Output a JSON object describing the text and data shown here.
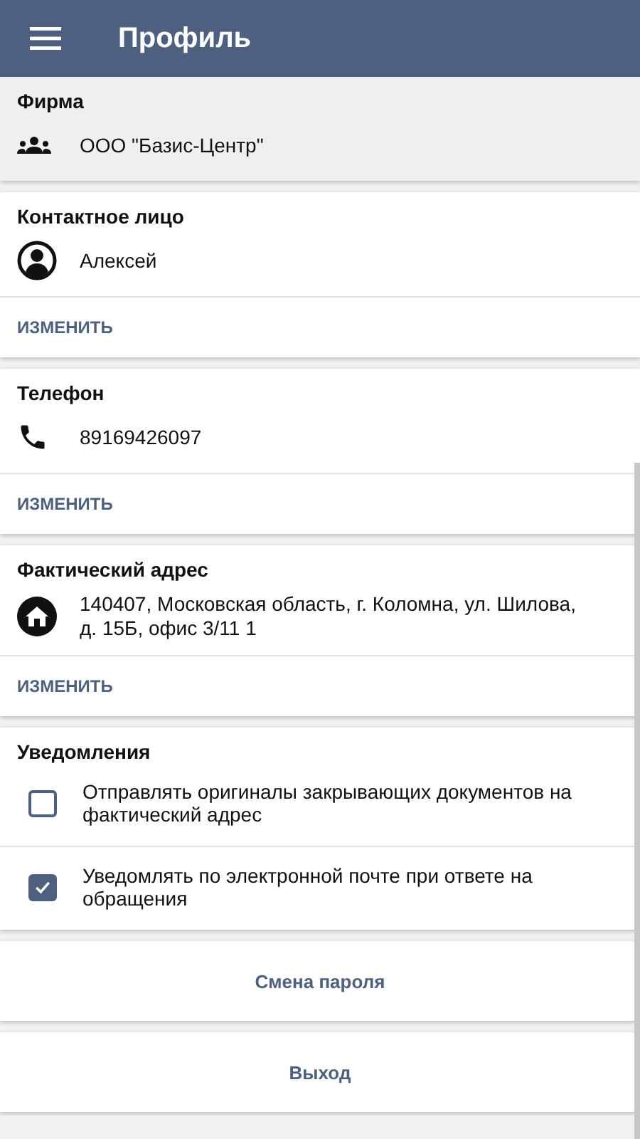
{
  "app_bar": {
    "title": "Профиль"
  },
  "sections": [
    {
      "kind": "firm",
      "title": "Фирма",
      "value": "ООО \"Базис-Центр\"",
      "readonly": true
    },
    {
      "kind": "contact",
      "title": "Контактное лицо",
      "value": "Алексей",
      "readonly": false,
      "action": "ИЗМЕНИТЬ"
    },
    {
      "kind": "phone",
      "title": "Телефон",
      "value": "89169426097",
      "readonly": false,
      "action": "ИЗМЕНИТЬ"
    },
    {
      "kind": "address",
      "title": "Фактический адрес",
      "value": "140407, Московская область, г. Коломна, ул. Шилова, д. 15Б, офис 3/11 1",
      "readonly": false,
      "action": "ИЗМЕНИТЬ"
    }
  ],
  "notifications": {
    "title": "Уведомления",
    "options": [
      {
        "label": "Отправлять оригиналы закрывающих документов на фактический адрес",
        "checked": false
      },
      {
        "label": "Уведомлять по электронной почте при ответе на обращения",
        "checked": true
      }
    ]
  },
  "buttons": [
    "Смена пароля",
    "Выход"
  ]
}
